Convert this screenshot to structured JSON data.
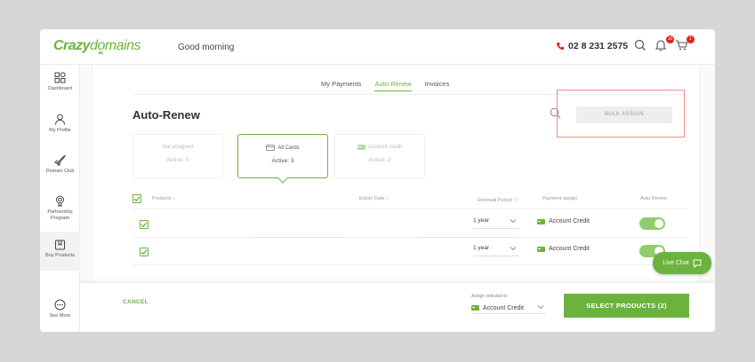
{
  "header": {
    "logo_main": "Crazy",
    "logo_sub": "domains",
    "logo_region": ".au",
    "greeting": "Good morning",
    "phone": "02 8 231 2575",
    "notification_count": "10",
    "cart_count": "1"
  },
  "sidebar": {
    "items": [
      {
        "label": "Dashboard",
        "icon": "dashboard-icon"
      },
      {
        "label": "My Profile",
        "icon": "user-icon"
      },
      {
        "label": "Domain Club",
        "icon": "rocket-icon"
      },
      {
        "label": "Partnership Program",
        "icon": "badge-icon"
      },
      {
        "label": "Buy Products",
        "icon": "box-icon"
      },
      {
        "label": "See More",
        "icon": "more-icon"
      }
    ]
  },
  "tabs": [
    {
      "label": "My Payments",
      "active": false
    },
    {
      "label": "Auto-Renew",
      "active": true
    },
    {
      "label": "Invoices",
      "active": false
    }
  ],
  "page": {
    "title": "Auto-Renew",
    "bulk_assign": "BULK ASSIGN"
  },
  "cards": [
    {
      "title": "Not assigned",
      "value": "Active: 0",
      "selected": false
    },
    {
      "title": "All Cards",
      "value": "Active: 3",
      "selected": true
    },
    {
      "title": "Account credit",
      "value": "Active: 2",
      "selected": false
    }
  ],
  "table": {
    "headers": {
      "products": "Products ↕",
      "expiry": "Expiry Date ↕",
      "renewal": "Renewal Period ⓘ",
      "payment": "Payment assign",
      "auto": "Auto Renew"
    },
    "rows": [
      {
        "renewal": "1 year",
        "payment": "Account Credit",
        "auto_renew": true
      },
      {
        "renewal": "1 year",
        "payment": "Account Credit",
        "auto_renew": true
      }
    ]
  },
  "live_chat": "Live Chat",
  "footer": {
    "cancel": "CANCEL",
    "assign_label": "Assign selected to",
    "assign_value": "Account Credit",
    "select_products": "SELECT PRODUCTS (2)"
  },
  "colors": {
    "brand": "#6cb33e",
    "toggle": "#8fce6a",
    "highlight": "#f08a8a"
  }
}
